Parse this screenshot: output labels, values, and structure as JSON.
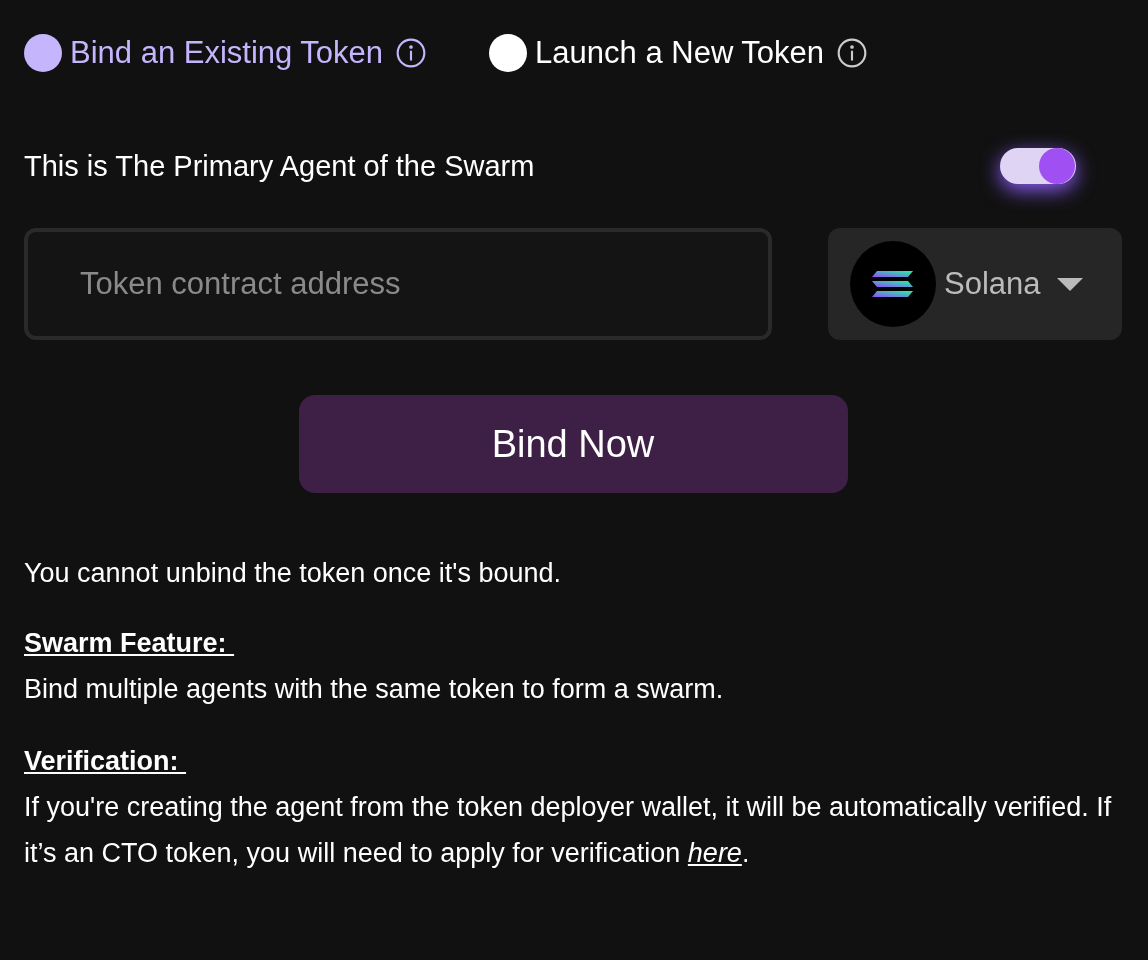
{
  "token_modes": [
    {
      "label": "Bind an Existing Token",
      "selected": true
    },
    {
      "label": "Launch a New Token",
      "selected": false
    }
  ],
  "primary_agent": {
    "label": "This is The Primary Agent of the Swarm",
    "on": true
  },
  "address_field": {
    "placeholder": "Token contract address"
  },
  "network_select": {
    "value": "Solana"
  },
  "bind_button": "Bind Now",
  "notice": "You cannot unbind the token once it's bound.",
  "sections": [
    {
      "heading": "Swarm Feature: ",
      "body": "Bind multiple agents with the same token to form a swarm."
    },
    {
      "heading": "Verification: ",
      "body": "If you're creating the agent from the token deployer wallet, it will be automatically verified. If it’s an CTO token, you will need to apply for verification ",
      "link": "here",
      "tail": "."
    }
  ]
}
